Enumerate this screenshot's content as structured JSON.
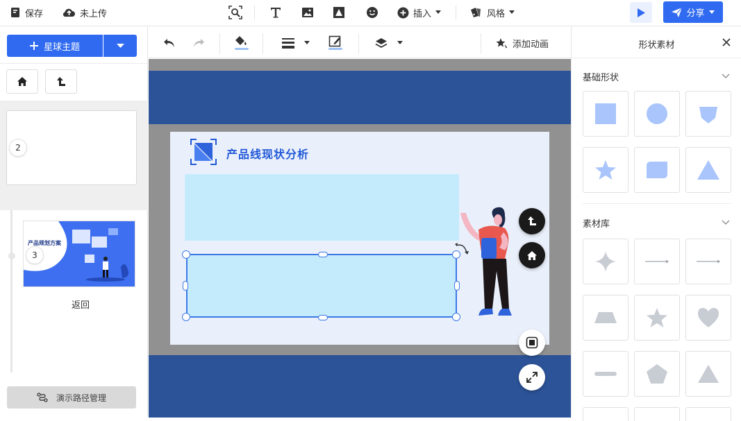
{
  "topbar": {
    "save_label": "保存",
    "upload_label": "未上传",
    "insert_label": "插入",
    "style_label": "风格",
    "share_label": "分享"
  },
  "left_panel": {
    "theme_button_label": "星球主题",
    "slides": [
      {
        "number": "2"
      },
      {
        "number": "3",
        "thumb_title": "产品规划方案",
        "caption": "返回"
      }
    ],
    "path_manage_label": "演示路径管理"
  },
  "toolbar2": {
    "add_animation_label": "添加动画"
  },
  "canvas": {
    "slide_title": "产品线现状分析"
  },
  "right_panel": {
    "title": "形状素材",
    "section_basic": "基础形状",
    "section_library": "素材库"
  },
  "colors": {
    "accent": "#2f6af0",
    "band": "#2c5398",
    "shape_fill": "#a9c5fb",
    "library_fill": "#c8ccd3",
    "rect_fill": "#c4ebfc"
  }
}
